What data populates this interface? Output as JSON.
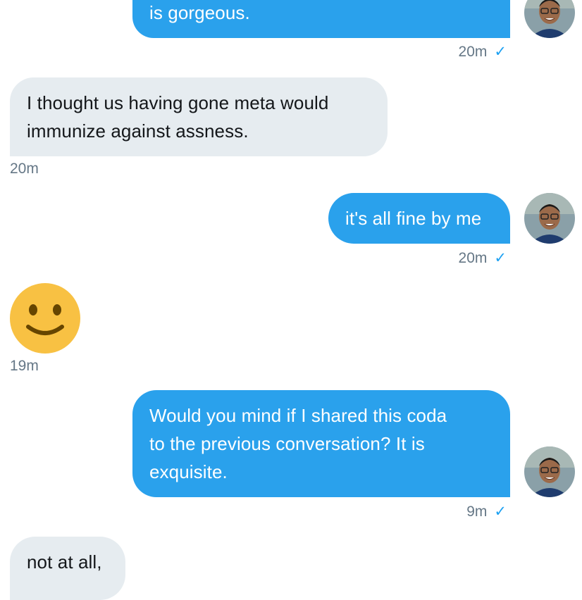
{
  "colors": {
    "outgoing_bubble": "#2aa1ec",
    "incoming_bubble": "#e6ecf0",
    "timestamp": "#657786",
    "read_check": "#1da1f2",
    "emoji_face": "#f8c143"
  },
  "messages": [
    {
      "direction": "outgoing",
      "lines": [
        "is gorgeous."
      ],
      "time": "20m",
      "read_icon": "check-icon"
    },
    {
      "direction": "incoming",
      "lines": [
        "I thought us having gone meta would",
        "immunize against assness."
      ],
      "time": "20m"
    },
    {
      "direction": "outgoing",
      "lines": [
        "it's all fine by me"
      ],
      "time": "20m",
      "read_icon": "check-icon"
    },
    {
      "direction": "incoming",
      "emoji": "slightly-smiling-face",
      "time": "19m"
    },
    {
      "direction": "outgoing",
      "lines": [
        "Would you mind if I shared this coda",
        "to the previous conversation? It is",
        "exquisite."
      ],
      "time": "9m",
      "read_icon": "check-icon"
    },
    {
      "direction": "incoming",
      "lines": [
        "not at all,"
      ]
    }
  ]
}
